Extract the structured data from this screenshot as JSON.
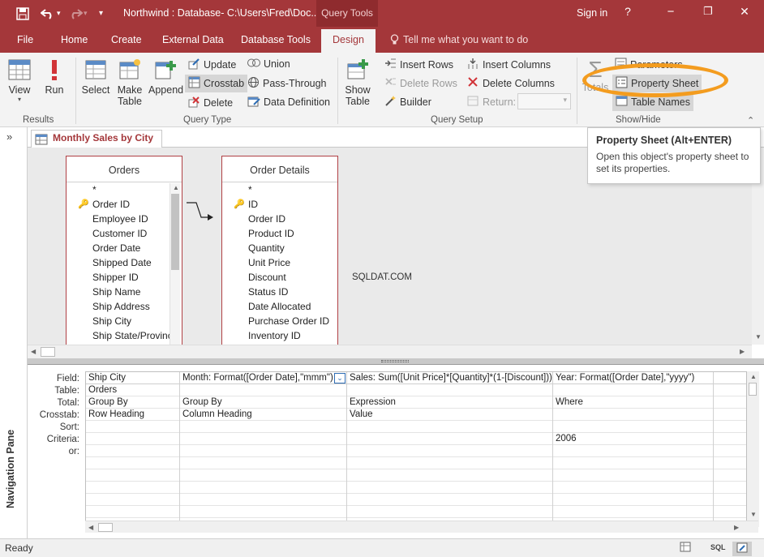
{
  "titlebar": {
    "title": "Northwind : Database- C:\\Users\\Fred\\Doc...",
    "context_tab": "Query Tools",
    "signin": "Sign in",
    "help": "?",
    "minimize": "−",
    "restore": "❐",
    "close": "✕"
  },
  "tabs": {
    "file": "File",
    "home": "Home",
    "create": "Create",
    "external": "External Data",
    "dbtools": "Database Tools",
    "design": "Design",
    "tellme": "Tell me what you want to do"
  },
  "ribbon": {
    "results": {
      "label": "Results",
      "view": "View",
      "run": "Run"
    },
    "query_type": {
      "label": "Query Type",
      "select": "Select",
      "make_table_1": "Make",
      "make_table_2": "Table",
      "append": "Append",
      "update": "Update",
      "crosstab": "Crosstab",
      "delete": "Delete",
      "union": "Union",
      "pass_through": "Pass-Through",
      "data_definition": "Data Definition"
    },
    "query_setup": {
      "label": "Query Setup",
      "show_table_1": "Show",
      "show_table_2": "Table",
      "insert_rows": "Insert Rows",
      "delete_rows": "Delete Rows",
      "builder": "Builder",
      "insert_columns": "Insert Columns",
      "delete_columns": "Delete Columns",
      "return": "Return:"
    },
    "show_hide": {
      "label": "Show/Hide",
      "totals": "Totals",
      "parameters": "Parameters",
      "property_sheet": "Property Sheet",
      "table_names": "Table Names"
    }
  },
  "tooltip": {
    "title": "Property Sheet (Alt+ENTER)",
    "body": "Open this object's property sheet to set its properties."
  },
  "navpane": {
    "label": "Navigation Pane",
    "toggle": "»"
  },
  "document": {
    "tab": "Monthly Sales by City"
  },
  "tables": [
    {
      "name": "Orders",
      "fields": [
        {
          "name": "*",
          "key": false
        },
        {
          "name": "Order ID",
          "key": true
        },
        {
          "name": "Employee ID",
          "key": false
        },
        {
          "name": "Customer ID",
          "key": false
        },
        {
          "name": "Order Date",
          "key": false
        },
        {
          "name": "Shipped Date",
          "key": false
        },
        {
          "name": "Shipper ID",
          "key": false
        },
        {
          "name": "Ship Name",
          "key": false
        },
        {
          "name": "Ship Address",
          "key": false
        },
        {
          "name": "Ship City",
          "key": false
        },
        {
          "name": "Ship State/Province",
          "key": false
        }
      ]
    },
    {
      "name": "Order Details",
      "fields": [
        {
          "name": "*",
          "key": false
        },
        {
          "name": "ID",
          "key": true
        },
        {
          "name": "Order ID",
          "key": false
        },
        {
          "name": "Product ID",
          "key": false
        },
        {
          "name": "Quantity",
          "key": false
        },
        {
          "name": "Unit Price",
          "key": false
        },
        {
          "name": "Discount",
          "key": false
        },
        {
          "name": "Status ID",
          "key": false
        },
        {
          "name": "Date Allocated",
          "key": false
        },
        {
          "name": "Purchase Order ID",
          "key": false
        },
        {
          "name": "Inventory ID",
          "key": false
        }
      ]
    }
  ],
  "watermark": "SQLDAT.COM",
  "grid": {
    "row_labels": [
      "Field:",
      "Table:",
      "Total:",
      "Crosstab:",
      "Sort:",
      "Criteria:",
      "or:"
    ],
    "columns": [
      {
        "field": "Ship City",
        "table": "Orders",
        "total": "Group By",
        "crosstab": "Row Heading",
        "sort": "",
        "criteria": "",
        "or": ""
      },
      {
        "field": "Month: Format([Order Date],\"mmm\")",
        "table": "",
        "total": "Group By",
        "crosstab": "Column Heading",
        "sort": "",
        "criteria": "",
        "or": ""
      },
      {
        "field": "Sales: Sum([Unit Price]*[Quantity]*(1-[Discount]))",
        "table": "",
        "total": "Expression",
        "crosstab": "Value",
        "sort": "",
        "criteria": "",
        "or": ""
      },
      {
        "field": "Year: Format([Order Date],\"yyyy\")",
        "table": "",
        "total": "Where",
        "crosstab": "",
        "sort": "",
        "criteria": "2006",
        "or": ""
      },
      {
        "field": "",
        "table": "",
        "total": "",
        "crosstab": "",
        "sort": "",
        "criteria": "",
        "or": ""
      }
    ]
  },
  "statusbar": {
    "ready": "Ready",
    "sql": "SQL"
  },
  "colors": {
    "accent": "#a4373a",
    "highlight_ring": "#f39c1f"
  }
}
